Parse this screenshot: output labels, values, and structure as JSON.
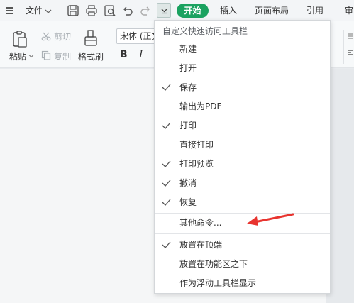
{
  "topbar": {
    "file_label": "文件",
    "tabs": [
      {
        "label": "开始",
        "active": true
      },
      {
        "label": "插入"
      },
      {
        "label": "页面布局"
      },
      {
        "label": "引用"
      },
      {
        "label": "审"
      }
    ],
    "accent_color": "#1ba260"
  },
  "ribbon": {
    "paste_label": "粘贴",
    "cut_label": "剪切",
    "copy_label": "复制",
    "format_painter_label": "格式刷",
    "font_name": "宋体 (正文)",
    "bold_label": "B",
    "italic_label": "I"
  },
  "dropdown": {
    "title": "自定义快速访问工具栏",
    "items": [
      {
        "label": "新建",
        "checked": false
      },
      {
        "label": "打开",
        "checked": false
      },
      {
        "label": "保存",
        "checked": true
      },
      {
        "label": "输出为PDF",
        "checked": false
      },
      {
        "label": "打印",
        "checked": true
      },
      {
        "label": "直接打印",
        "checked": false
      },
      {
        "label": "打印预览",
        "checked": true
      },
      {
        "label": "撤消",
        "checked": true
      },
      {
        "label": "恢复",
        "checked": true
      }
    ],
    "other_commands": "其他命令...",
    "position_items": [
      {
        "label": "放置在顶端",
        "checked": true
      },
      {
        "label": "放置在功能区之下",
        "checked": false
      },
      {
        "label": "作为浮动工具栏显示",
        "checked": false
      }
    ]
  },
  "annotation": {
    "arrow_color": "#e8342f"
  }
}
